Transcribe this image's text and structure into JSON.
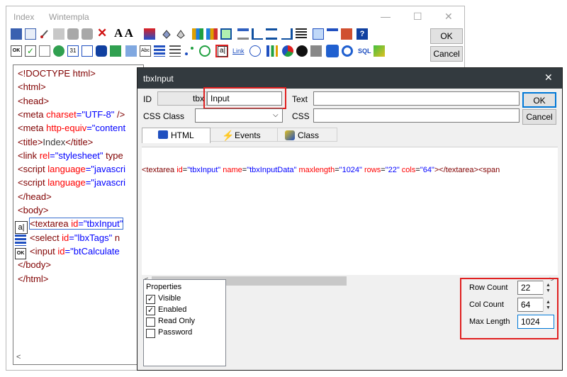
{
  "back_window": {
    "title_left": "Index",
    "title_right": "Wintempla",
    "min_glyph": "—",
    "max_glyph": "☐",
    "close_glyph": "✕",
    "ok_label": "OK",
    "cancel_label": "Cancel",
    "toolbar_text": {
      "aa": "A A",
      "link": "Link",
      "abc": "Abc",
      "sql": "SQL",
      "al": "a|",
      "num31": "31"
    },
    "code_lines": [
      {
        "l": "<!DOCTYPE html>"
      },
      {
        "l": "<html>"
      },
      {
        "l": "<head>"
      },
      {
        "l": "<meta ",
        "a": "charset",
        "v": "=\"UTF-8\"",
        "r": " />"
      },
      {
        "l": "<meta ",
        "a": "http-equiv",
        "v": "=\"content"
      },
      {
        "l": "<title>",
        "t": "Index",
        "r": "</title>"
      },
      {
        "l": "<link ",
        "a": "rel",
        "v": "=\"stylesheet\"",
        "r": "  type"
      },
      {
        "l": "<script ",
        "a": "language",
        "v": "=\"javascri"
      },
      {
        "l": "<script ",
        "a": "language",
        "v": "=\"javascri"
      },
      {
        "l": "</head>"
      },
      {
        "l": "<body>"
      },
      {
        "l": "<textarea ",
        "a": "id",
        "v": "=\"tbxInput\""
      },
      {
        "l": "<select ",
        "a": "id",
        "v": "=\"lbxTags\"",
        "r": "  n"
      },
      {
        "l": "<input ",
        "a": "id",
        "v": "=\"btCalculate"
      },
      {
        "l": "</body>"
      },
      {
        "l": "</html>"
      }
    ],
    "line_icons": {
      "textarea": "a|",
      "input": "OK"
    },
    "scroll_glyph": "<"
  },
  "dialog": {
    "title": "tbxInput",
    "close_glyph": "✕",
    "id_label": "ID",
    "id_prefix": "tbx",
    "id_value": "Input",
    "text_label": "Text",
    "text_value": "",
    "ok_label": "OK",
    "css_class_label": "CSS Class",
    "css_class_value": "",
    "css_label": "CSS",
    "css_value": "",
    "cancel_label": "Cancel",
    "tabs": [
      "HTML",
      "Events",
      "Class"
    ],
    "editor_text": "<textarea id=\"tbxInput\" name=\"tbxInputData\" maxlength=\"1024\" rows=\"22\" cols=\"64\"></textarea><span",
    "scroll_left": "<",
    "scroll_right": ">",
    "properties": {
      "title": "Properties",
      "items": [
        {
          "label": "Visible",
          "checked": true
        },
        {
          "label": "Enabled",
          "checked": true
        },
        {
          "label": "Read Only",
          "checked": false
        },
        {
          "label": "Password",
          "checked": false
        }
      ]
    },
    "row_count_label": "Row Count",
    "row_count_value": "22",
    "col_count_label": "Col Count",
    "col_count_value": "64",
    "max_length_label": "Max Length",
    "max_length_value": "1024"
  },
  "colors": {
    "highlight": "#e02020",
    "dialog_title_bg": "#333a3f",
    "tag": "#800000",
    "attr": "#ff0000",
    "value": "#0000ff"
  }
}
